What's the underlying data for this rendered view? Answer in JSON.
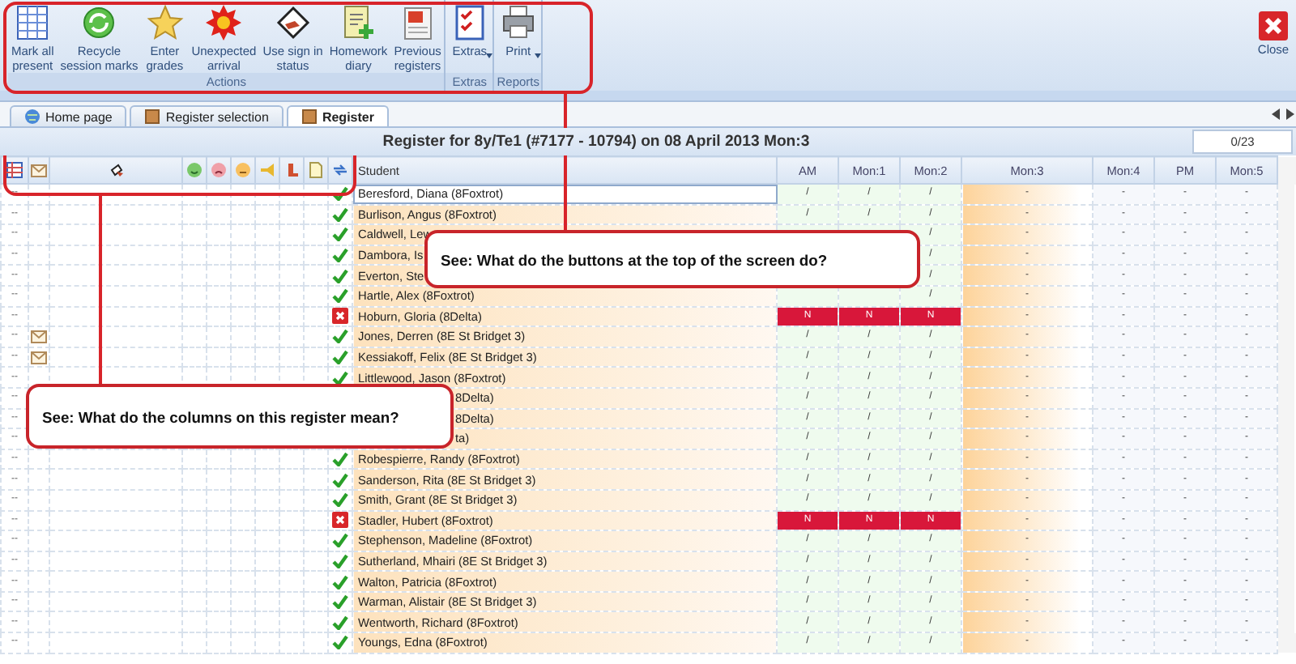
{
  "toolbar": {
    "groups": [
      {
        "label": "Actions",
        "buttons": [
          {
            "label": "Mark all\npresent"
          },
          {
            "label": "Recycle\nsession marks"
          },
          {
            "label": "Enter\ngrades"
          },
          {
            "label": "Unexpected\narrival"
          },
          {
            "label": "Use sign in\nstatus"
          },
          {
            "label": "Homework\ndiary"
          },
          {
            "label": "Previous\nregisters"
          }
        ]
      },
      {
        "label": "Extras",
        "buttons": [
          {
            "label": "Extras",
            "dropdown": true
          }
        ]
      },
      {
        "label": "Reports",
        "buttons": [
          {
            "label": "Print",
            "dropdown": true
          }
        ]
      }
    ],
    "close": "Close"
  },
  "tabs": [
    {
      "label": "Home page",
      "selected": false
    },
    {
      "label": "Register selection",
      "selected": false
    },
    {
      "label": "Register",
      "selected": true
    }
  ],
  "register": {
    "title": "Register for 8y/Te1 (#7177 - 10794) on 08 April 2013 Mon:3",
    "counter": "0/23"
  },
  "student_header": "Student",
  "periods": [
    {
      "label": "AM",
      "taken": true,
      "current": false
    },
    {
      "label": "Mon:1",
      "taken": true,
      "current": false
    },
    {
      "label": "Mon:2",
      "taken": true,
      "current": false
    },
    {
      "label": "Mon:3",
      "taken": false,
      "current": true
    },
    {
      "label": "Mon:4",
      "taken": false,
      "current": false
    },
    {
      "label": "PM",
      "taken": false,
      "current": false
    },
    {
      "label": "Mon:5",
      "taken": false,
      "current": false
    }
  ],
  "rows": [
    {
      "marker": "--",
      "message": false,
      "present": true,
      "name": "Beresford, Diana (8Foxtrot)",
      "selected": true,
      "cells": [
        "/",
        "/",
        "/",
        "-",
        "-",
        "-",
        "-"
      ]
    },
    {
      "marker": "--",
      "message": false,
      "present": true,
      "name": "Burlison, Angus (8Foxtrot)",
      "selected": false,
      "cells": [
        "/",
        "/",
        "/",
        "-",
        "-",
        "-",
        "-"
      ]
    },
    {
      "marker": "--",
      "message": false,
      "present": true,
      "name": "Caldwell, Lew",
      "selected": false,
      "cells": [
        null,
        null,
        "/",
        "-",
        "-",
        "-",
        "-"
      ]
    },
    {
      "marker": "--",
      "message": false,
      "present": true,
      "name": "Dambora, Is",
      "selected": false,
      "cells": [
        null,
        null,
        "/",
        "-",
        "-",
        "-",
        "-"
      ]
    },
    {
      "marker": "--",
      "message": false,
      "present": true,
      "name": "Everton, Ste",
      "selected": false,
      "cells": [
        null,
        null,
        "/",
        "-",
        "-",
        "-",
        "-"
      ]
    },
    {
      "marker": "--",
      "message": false,
      "present": true,
      "name": "Hartle, Alex (8Foxtrot)",
      "selected": false,
      "cells": [
        null,
        null,
        "/",
        "-",
        "-",
        "-",
        "-"
      ]
    },
    {
      "marker": "--",
      "message": false,
      "present": false,
      "name": "Hoburn, Gloria (8Delta)",
      "selected": false,
      "cells": [
        "N",
        "N",
        "N",
        "-",
        "-",
        "-",
        "-"
      ]
    },
    {
      "marker": "--",
      "message": true,
      "present": true,
      "name": "Jones, Derren (8E St Bridget 3)",
      "selected": false,
      "cells": [
        "/",
        "/",
        "/",
        "-",
        "-",
        "-",
        "-"
      ]
    },
    {
      "marker": "--",
      "message": true,
      "present": true,
      "name": "Kessiakoff, Felix (8E St Bridget 3)",
      "selected": false,
      "cells": [
        "/",
        "/",
        "/",
        "-",
        "-",
        "-",
        "-"
      ]
    },
    {
      "marker": "--",
      "message": false,
      "present": true,
      "name": "Littlewood, Jason (8Foxtrot)",
      "selected": false,
      "cells": [
        "/",
        "/",
        "/",
        "-",
        "-",
        "-",
        "-"
      ]
    },
    {
      "marker": "--",
      "name": "8Delta)",
      "selected": false,
      "cells": [
        "/",
        "/",
        "/",
        "-",
        "-",
        "-",
        "-"
      ]
    },
    {
      "marker": "--",
      "name": "8Delta)",
      "selected": false,
      "cells": [
        "/",
        "/",
        "/",
        "-",
        "-",
        "-",
        "-"
      ]
    },
    {
      "marker": "--",
      "name": "ta)",
      "selected": false,
      "cells": [
        "/",
        "/",
        "/",
        "-",
        "-",
        "-",
        "-"
      ]
    },
    {
      "marker": "--",
      "message": false,
      "present": true,
      "name": "Robespierre, Randy (8Foxtrot)",
      "selected": false,
      "cells": [
        "/",
        "/",
        "/",
        "-",
        "-",
        "-",
        "-"
      ]
    },
    {
      "marker": "--",
      "message": false,
      "present": true,
      "name": "Sanderson, Rita (8E St Bridget 3)",
      "selected": false,
      "cells": [
        "/",
        "/",
        "/",
        "-",
        "-",
        "-",
        "-"
      ]
    },
    {
      "marker": "--",
      "message": false,
      "present": true,
      "name": "Smith, Grant (8E St Bridget 3)",
      "selected": false,
      "cells": [
        "/",
        "/",
        "/",
        "-",
        "-",
        "-",
        "-"
      ]
    },
    {
      "marker": "--",
      "message": false,
      "present": false,
      "name": "Stadler, Hubert (8Foxtrot)",
      "selected": false,
      "cells": [
        "N",
        "N",
        "N",
        "-",
        "-",
        "-",
        "-"
      ]
    },
    {
      "marker": "--",
      "message": false,
      "present": true,
      "name": "Stephenson, Madeline (8Foxtrot)",
      "selected": false,
      "cells": [
        "/",
        "/",
        "/",
        "-",
        "-",
        "-",
        "-"
      ]
    },
    {
      "marker": "--",
      "message": false,
      "present": true,
      "name": "Sutherland, Mhairi (8E St Bridget 3)",
      "selected": false,
      "cells": [
        "/",
        "/",
        "/",
        "-",
        "-",
        "-",
        "-"
      ]
    },
    {
      "marker": "--",
      "message": false,
      "present": true,
      "name": "Walton, Patricia (8Foxtrot)",
      "selected": false,
      "cells": [
        "/",
        "/",
        "/",
        "-",
        "-",
        "-",
        "-"
      ]
    },
    {
      "marker": "--",
      "message": false,
      "present": true,
      "name": "Warman, Alistair (8E St Bridget 3)",
      "selected": false,
      "cells": [
        "/",
        "/",
        "/",
        "-",
        "-",
        "-",
        "-"
      ]
    },
    {
      "marker": "--",
      "message": false,
      "present": true,
      "name": "Wentworth, Richard (8Foxtrot)",
      "selected": false,
      "cells": [
        "/",
        "/",
        "/",
        "-",
        "-",
        "-",
        "-"
      ]
    },
    {
      "marker": "--",
      "message": false,
      "present": true,
      "name": "Youngs, Edna (8Foxtrot)",
      "selected": false,
      "cells": [
        "/",
        "/",
        "/",
        "-",
        "-",
        "-",
        "-"
      ]
    }
  ],
  "annotations": [
    {
      "text": "See: What do the buttons at the top of the screen do?"
    },
    {
      "text": "See: What do the columns on this register mean?"
    }
  ]
}
